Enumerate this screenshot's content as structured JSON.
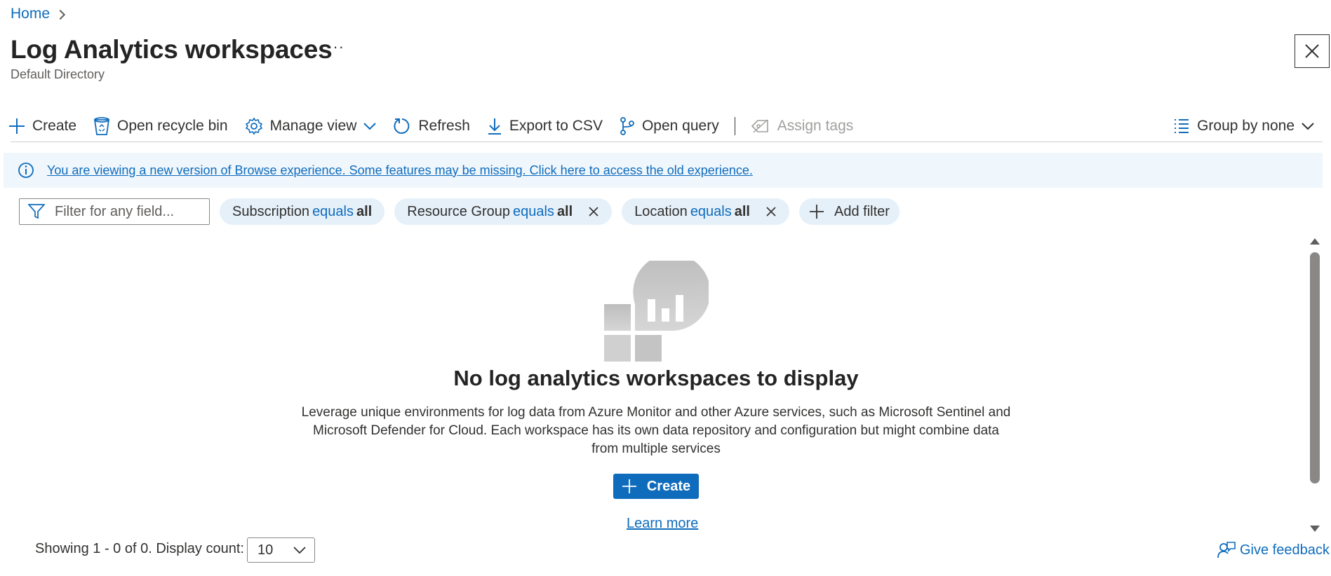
{
  "breadcrumb": {
    "home": "Home"
  },
  "header": {
    "title": "Log Analytics workspaces",
    "more": "···",
    "subtitle": "Default Directory"
  },
  "toolbar": {
    "create": "Create",
    "recycle_bin": "Open recycle bin",
    "manage_view": "Manage view",
    "refresh": "Refresh",
    "export_csv": "Export to CSV",
    "open_query": "Open query",
    "assign_tags": "Assign tags",
    "group_by": "Group by none"
  },
  "info_bar": {
    "message": "You are viewing a new version of Browse experience. Some features may be missing. Click here to access the old experience."
  },
  "filters": {
    "search_placeholder": "Filter for any field...",
    "pills": [
      {
        "field": "Subscription",
        "op": "equals",
        "value": "all"
      },
      {
        "field": "Resource Group",
        "op": "equals",
        "value": "all"
      },
      {
        "field": "Location",
        "op": "equals",
        "value": "all"
      }
    ],
    "add_filter": "Add filter"
  },
  "empty_state": {
    "title": "No log analytics workspaces to display",
    "description": "Leverage unique environments for log data from Azure Monitor and other Azure services, such as Microsoft Sentinel and Microsoft Defender for Cloud. Each workspace has its own data repository and configuration but might combine data from multiple services",
    "create_label": "Create",
    "learn_more": "Learn more"
  },
  "footer": {
    "showing": "Showing 1 - 0 of 0. Display count:",
    "display_count": "10",
    "feedback": "Give feedback"
  },
  "colors": {
    "accent": "#0f6cbd",
    "info_bg": "#eff6fc",
    "pill_bg": "#e6f0f9"
  },
  "icons": [
    "chevron-right-icon",
    "ellipsis-icon",
    "close-icon",
    "plus-icon",
    "recycle-bin-icon",
    "gear-icon",
    "chevron-down-icon",
    "refresh-icon",
    "download-icon",
    "query-icon",
    "tag-icon",
    "list-icon",
    "info-icon",
    "funnel-icon",
    "dismiss-icon",
    "workspace-illustration",
    "feedback-icon"
  ]
}
